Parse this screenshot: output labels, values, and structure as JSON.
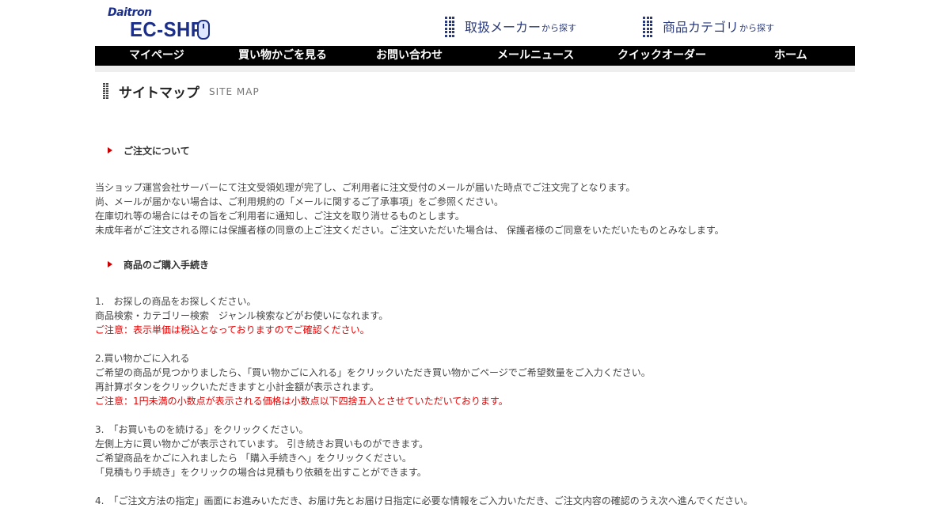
{
  "header": {
    "logo_small": "Daitron",
    "logo_main": "EC-SHP",
    "maker_link_big": "取扱メーカー",
    "maker_link_small": "から探す",
    "category_link_big": "商品カテゴリ",
    "category_link_small": "から探す"
  },
  "nav": {
    "items": [
      {
        "label": "マイページ"
      },
      {
        "label": "買い物かごを見る"
      },
      {
        "label": "お問い合わせ"
      },
      {
        "label": "メールニュース"
      },
      {
        "label": "クイックオーダー"
      },
      {
        "label": "ホーム"
      }
    ]
  },
  "page": {
    "title": "サイトマップ",
    "title_en": "SITE MAP"
  },
  "sections": [
    {
      "heading": "ご注文について",
      "lines": [
        "当ショップ運営会社サーバーにて注文受領処理が完了し、ご利用者に注文受付のメールが届いた時点でご注文完了となります。",
        "尚、メールが届かない場合は、ご利用規約の「メールに関するご了承事項」をご参照ください。",
        "在庫切れ等の場合にはその旨をご利用者に通知し、ご注文を取り消せるものとします。",
        "未成年者がご注文される際には保護者様の同意の上ご注文ください。ご注文いただいた場合は、 保護者様のご同意をいただいたものとみなします。"
      ]
    },
    {
      "heading": "商品のご購入手続き",
      "steps": [
        {
          "lines": [
            "1.　お探しの商品をお探しください。",
            "商品検索・カテゴリー検索　ジャンル検索などがお使いになれます。"
          ],
          "note": "ご注意：表示単価は税込となっておりますのでご確認ください。"
        },
        {
          "lines": [
            "2.買い物かごに入れる",
            "ご希望の商品が見つかりましたら、「買い物かごに入れる」をクリックいただき買い物かごページでご希望数量をご入力ください。",
            "再計算ボタンをクリックいただきますと小計金額が表示されます。"
          ],
          "note": "ご注意：1円未満の小数点が表示される価格は小数点以下四捨五入とさせていただいております。"
        },
        {
          "lines": [
            "3.　「お買いものを続ける」をクリックください。",
            "左側上方に買い物かごが表示されています。 引き続きお買いものができます。",
            "ご希望商品をかごに入れましたら 「購入手続きへ」をクリックください。",
            "「見積もり手続き」をクリックの場合は見積もり依頼を出すことができます。"
          ]
        },
        {
          "lines": [
            "4.　「ご注文方法の指定」画面にお進みいただき、お届け先とお届け日指定に必要な情報をご入力いただき、ご注文内容の確認のうえ次へ進んでください。"
          ]
        }
      ]
    }
  ]
}
